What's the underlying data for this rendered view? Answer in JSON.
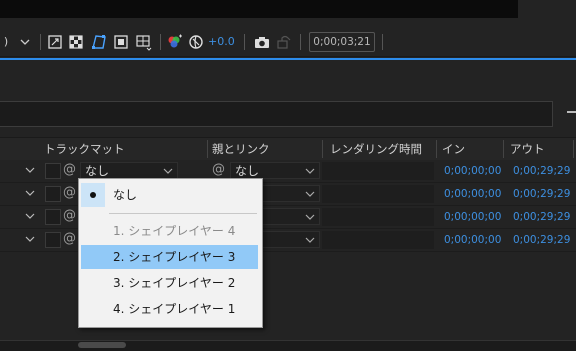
{
  "toolbar": {
    "paren": ")",
    "exposure_value": "+0.0",
    "timecode": "0;00;03;21"
  },
  "columns": {
    "track_matte": "トラックマット",
    "parent_link": "親とリンク",
    "render_time": "レンダリング時間",
    "in": "イン",
    "out": "アウト"
  },
  "rows": [
    {
      "matte": "なし",
      "parent": "なし",
      "in": "0;00;00;00",
      "out": "0;00;29;29"
    },
    {
      "matte": "",
      "parent": "",
      "in": "0;00;00;00",
      "out": "0;00;29;29"
    },
    {
      "matte": "",
      "parent": "",
      "in": "0;00;00;00",
      "out": "0;00;29;29"
    },
    {
      "matte": "",
      "parent": "",
      "in": "0;00;00;00",
      "out": "0;00;29;29"
    }
  ],
  "menu": {
    "items": [
      {
        "label": "なし",
        "checked": true
      },
      {
        "label": "1. シェイプレイヤー 4",
        "disabled": true
      },
      {
        "label": "2. シェイプレイヤー 3",
        "selected": true
      },
      {
        "label": "3. シェイプレイヤー 2"
      },
      {
        "label": "4. シェイプレイヤー 1"
      }
    ]
  },
  "colors": {
    "accent_blue": "#2d8ceb",
    "timecode_blue": "#3d8fe0",
    "menu_highlight": "#91c9f7"
  }
}
